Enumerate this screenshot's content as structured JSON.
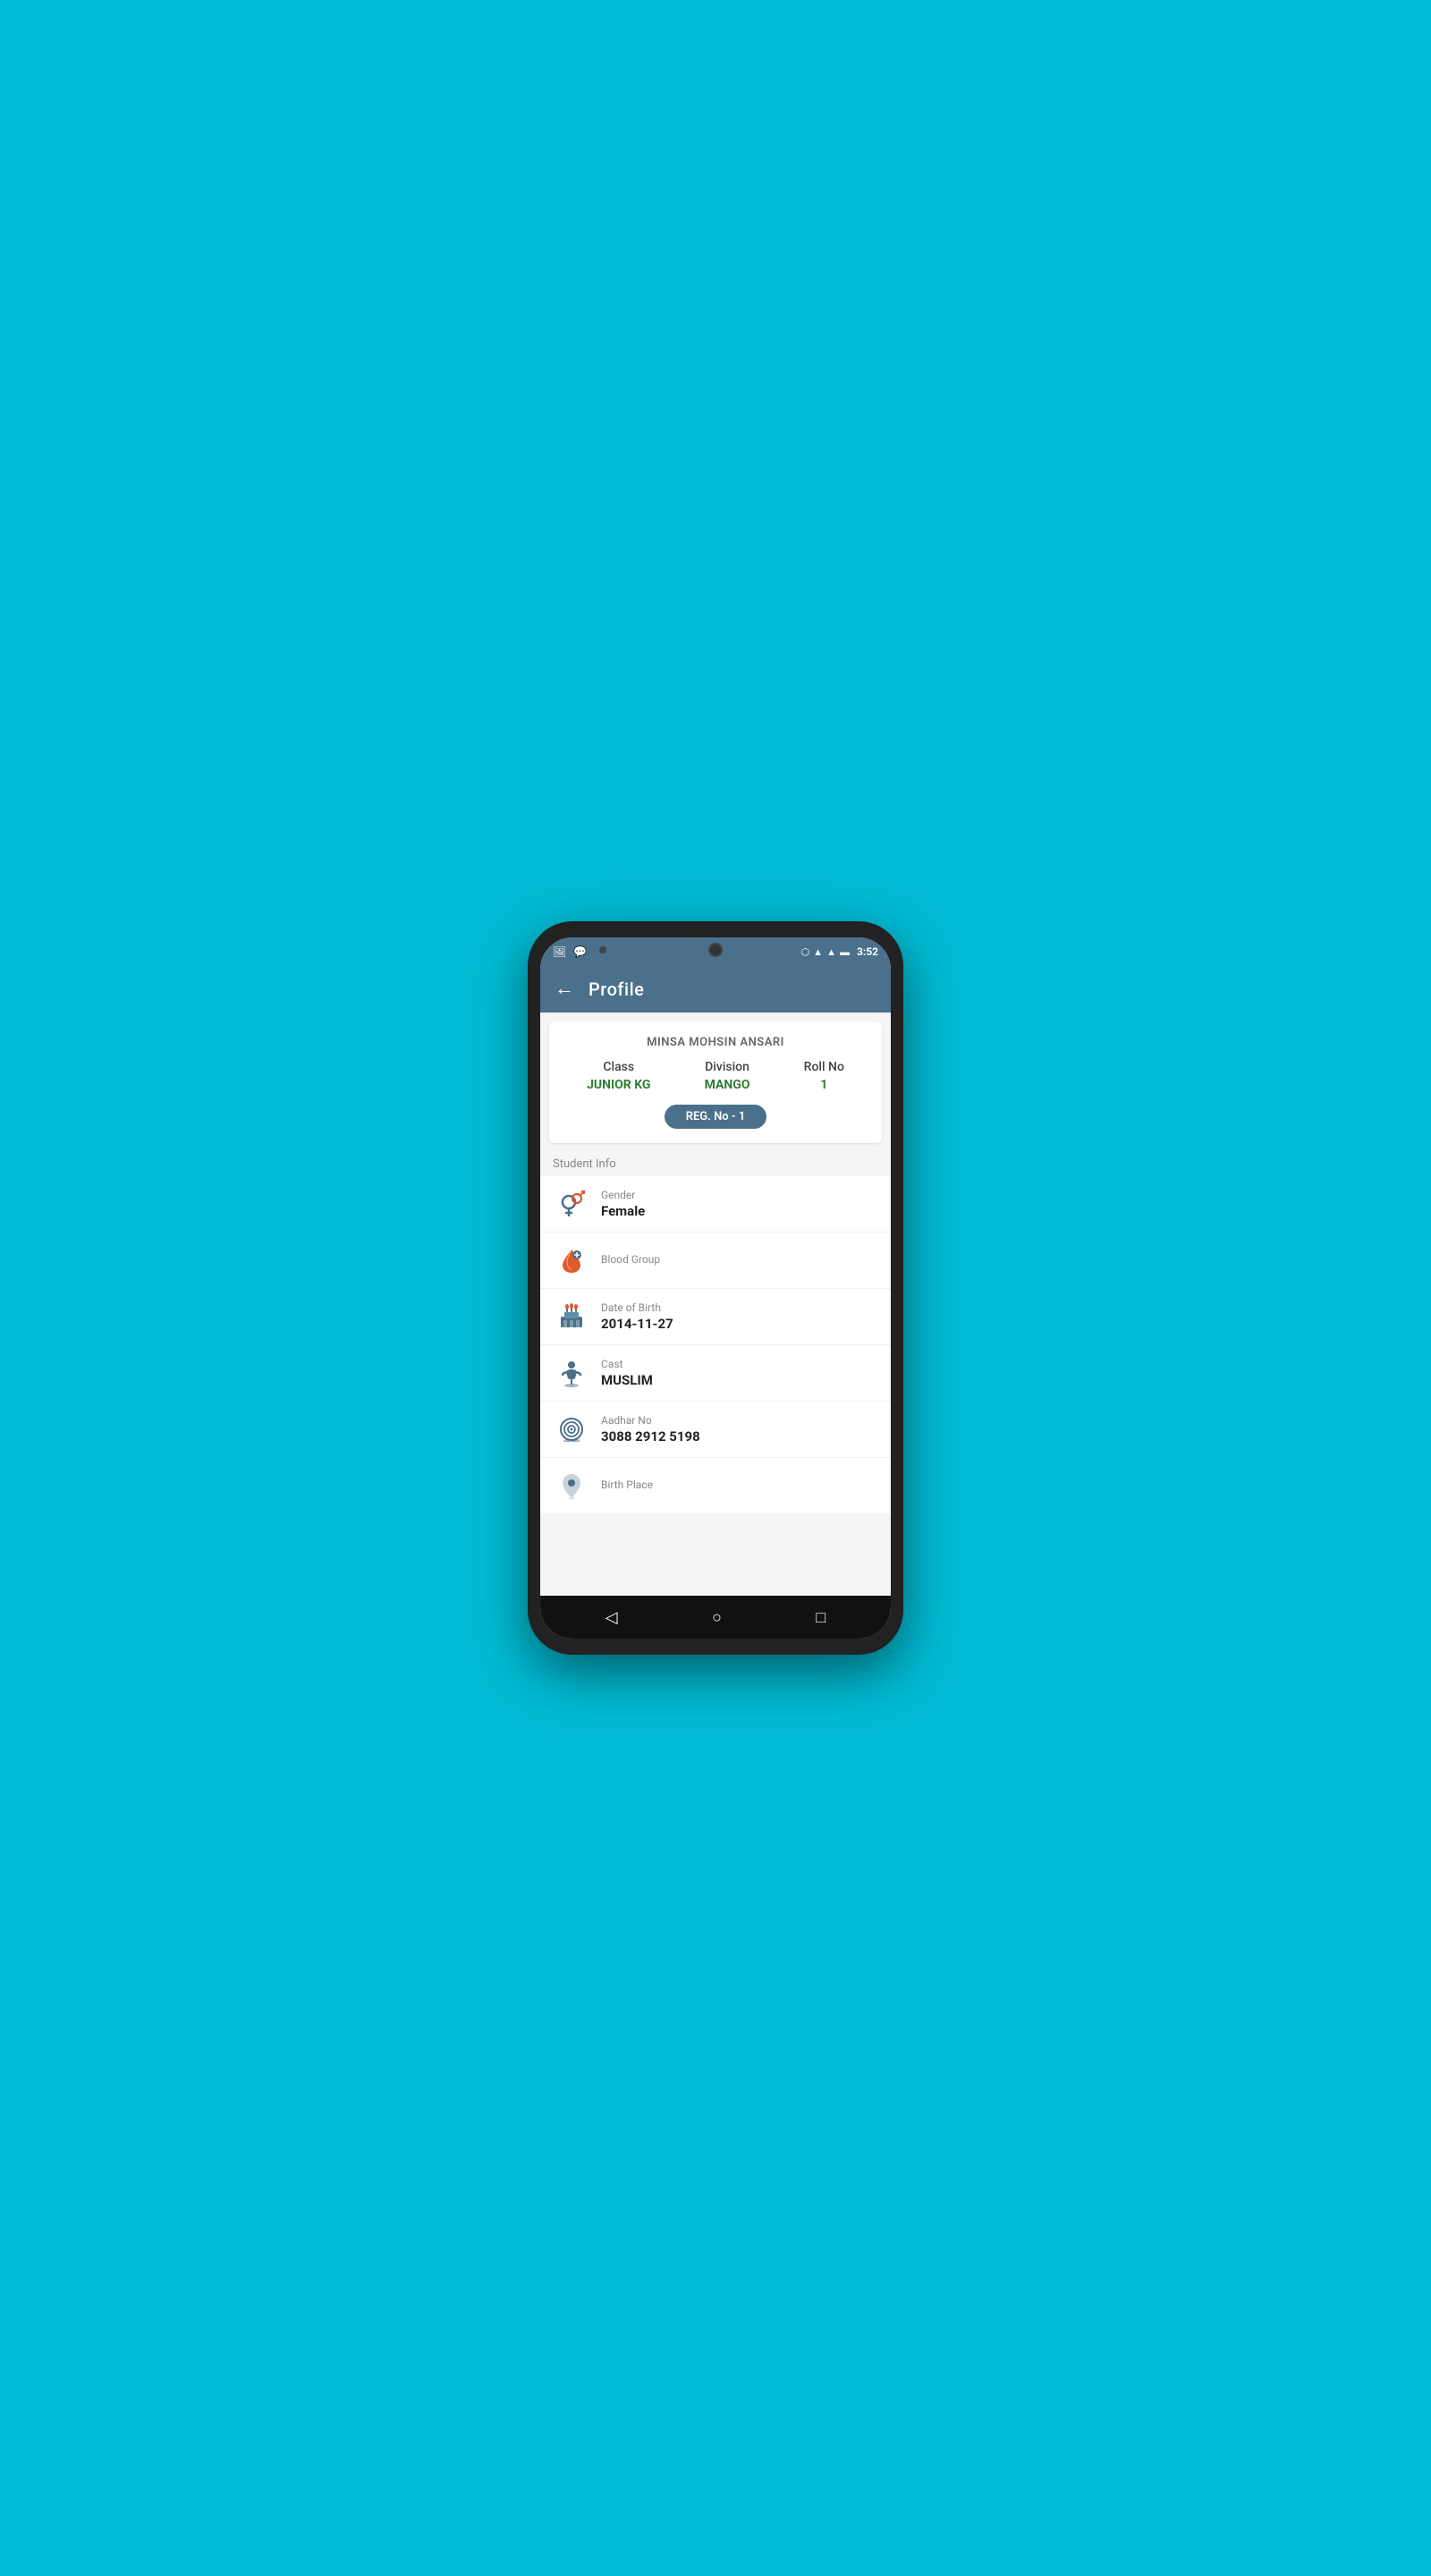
{
  "statusBar": {
    "time": "3:52",
    "icons": [
      "image",
      "whatsapp",
      "wifi",
      "signal1",
      "signal2",
      "battery"
    ]
  },
  "toolbar": {
    "back": "←",
    "title": "Profile"
  },
  "profile": {
    "name": "MINSA MOHSIN ANSARI",
    "classLabel": "Class",
    "classValue": "JUNIOR KG",
    "divisionLabel": "Division",
    "divisionValue": "MANGO",
    "rollLabel": "Roll No",
    "rollValue": "1",
    "regBadge": "REG. No - 1"
  },
  "studentInfo": {
    "sectionTitle": "Student Info",
    "items": [
      {
        "id": "gender",
        "label": "Gender",
        "value": "Female",
        "icon": "gender"
      },
      {
        "id": "blood-group",
        "label": "Blood Group",
        "value": "",
        "icon": "blood"
      },
      {
        "id": "dob",
        "label": "Date of Birth",
        "value": "2014-11-27",
        "icon": "cake"
      },
      {
        "id": "cast",
        "label": "Cast",
        "value": "MUSLIM",
        "icon": "cast"
      },
      {
        "id": "aadhar",
        "label": "Aadhar No",
        "value": "3088 2912 5198",
        "icon": "aadhar"
      },
      {
        "id": "birth-place",
        "label": "Birth Place",
        "value": "",
        "icon": "location"
      }
    ]
  },
  "navBar": {
    "back": "◁",
    "home": "○",
    "recent": "□"
  }
}
